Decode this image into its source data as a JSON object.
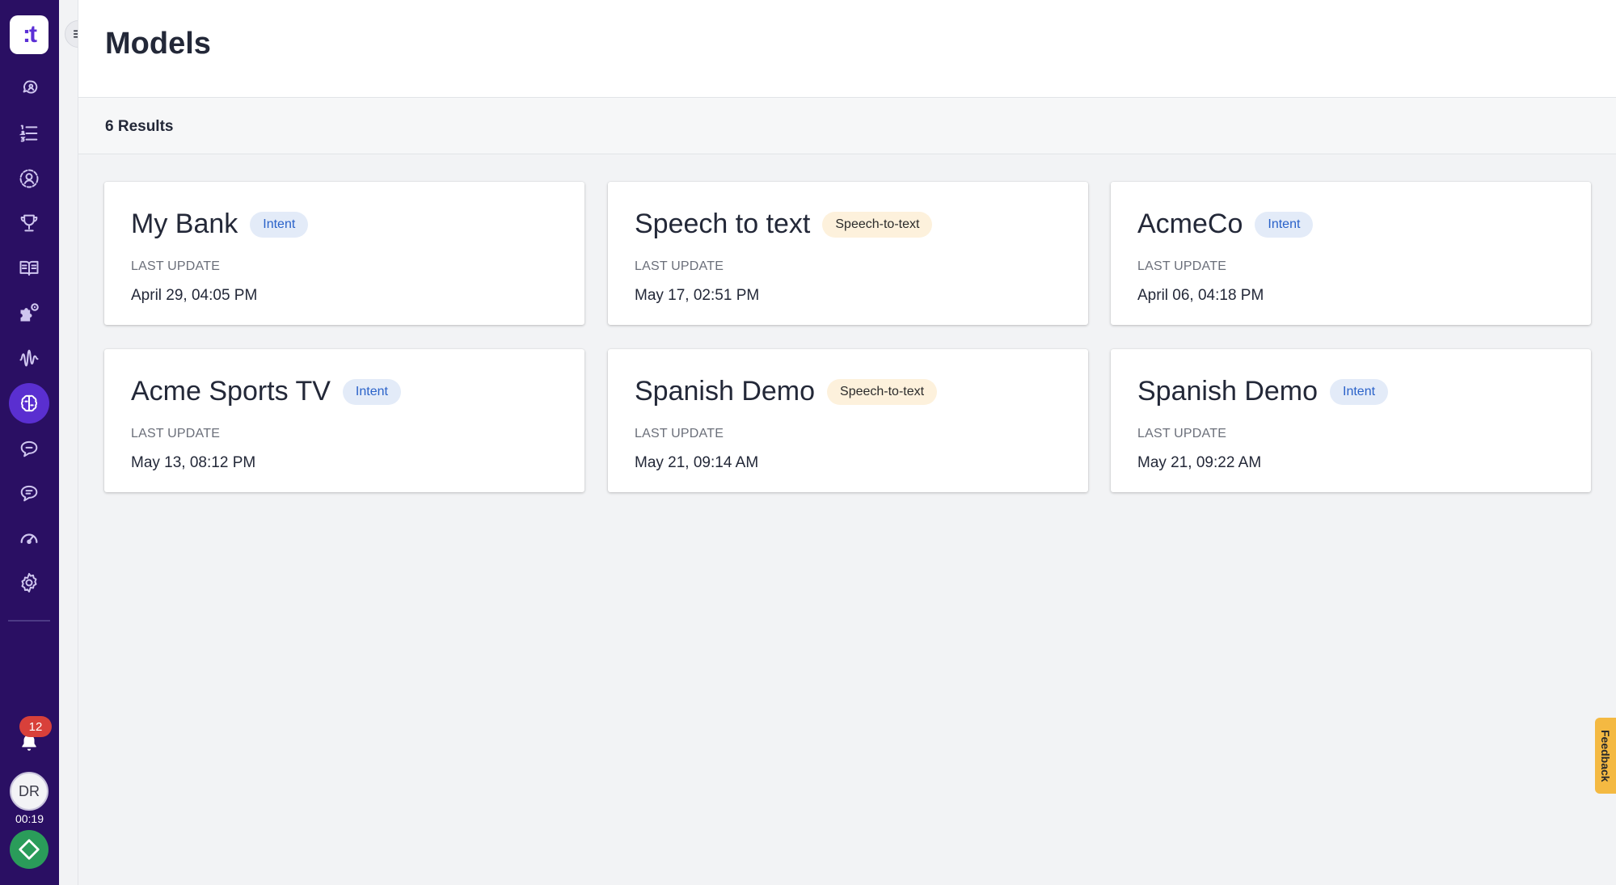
{
  "sidebar": {
    "logo_text": ":t",
    "nav": [
      {
        "icon": "chat-person-icon"
      },
      {
        "icon": "list-icon"
      },
      {
        "icon": "person-circle-icon"
      },
      {
        "icon": "trophy-icon"
      },
      {
        "icon": "book-icon"
      },
      {
        "icon": "puzzle-gear-icon"
      },
      {
        "icon": "waveform-icon"
      },
      {
        "icon": "brain-icon",
        "active": true
      },
      {
        "icon": "chat-bubble-icon"
      },
      {
        "icon": "chat-bubble-alt-icon"
      },
      {
        "icon": "gauge-icon"
      },
      {
        "icon": "gear-icon"
      }
    ],
    "notifications_count": "12",
    "avatar_initials": "DR",
    "timer": "00:19"
  },
  "header": {
    "title": "Models"
  },
  "results": {
    "count_text": "6 Results"
  },
  "cards": [
    {
      "title": "My Bank",
      "tag": "Intent",
      "tag_type": "intent",
      "label": "LAST UPDATE",
      "date": "April 29, 04:05 PM"
    },
    {
      "title": "Speech to text",
      "tag": "Speech-to-text",
      "tag_type": "stt",
      "label": "LAST UPDATE",
      "date": "May 17, 02:51 PM"
    },
    {
      "title": "AcmeCo",
      "tag": "Intent",
      "tag_type": "intent",
      "label": "LAST UPDATE",
      "date": "April 06, 04:18 PM"
    },
    {
      "title": "Acme Sports TV",
      "tag": "Intent",
      "tag_type": "intent",
      "label": "LAST UPDATE",
      "date": "May 13, 08:12 PM"
    },
    {
      "title": "Spanish Demo",
      "tag": "Speech-to-text",
      "tag_type": "stt",
      "label": "LAST UPDATE",
      "date": "May 21, 09:14 AM"
    },
    {
      "title": "Spanish Demo",
      "tag": "Intent",
      "tag_type": "intent",
      "label": "LAST UPDATE",
      "date": "May 21, 09:22 AM"
    }
  ],
  "feedback_label": "Feedback",
  "colors": {
    "sidebar_bg": "#2a0f63",
    "active_nav": "#5a2fd0",
    "intent_tag_bg": "#e3ebf8",
    "intent_tag_text": "#2a62c9",
    "stt_tag_bg": "#fdf1dc",
    "badge": "#d8403a",
    "status_green": "#2a9c5a",
    "feedback_bg": "#f4b942"
  }
}
